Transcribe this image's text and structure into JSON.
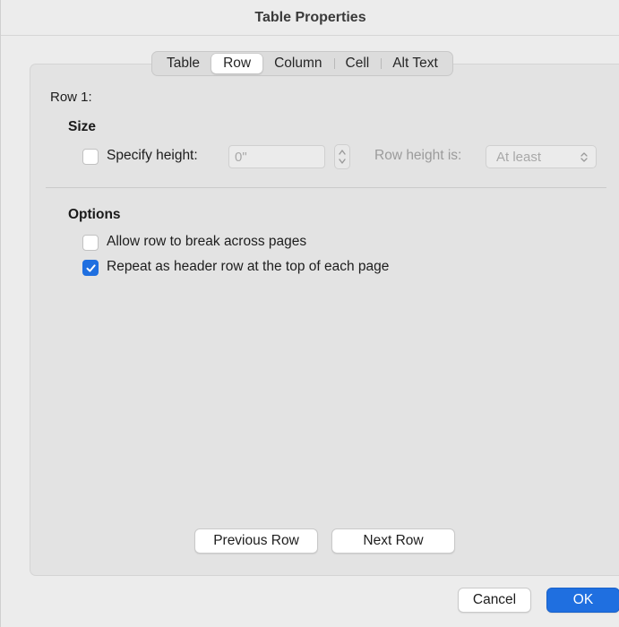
{
  "window": {
    "title": "Table Properties"
  },
  "tabs": [
    {
      "label": "Table",
      "active": false
    },
    {
      "label": "Row",
      "active": true
    },
    {
      "label": "Column",
      "active": false
    },
    {
      "label": "Cell",
      "active": false
    },
    {
      "label": "Alt Text",
      "active": false
    }
  ],
  "row_label": "Row 1:",
  "size": {
    "title": "Size",
    "specify_height": {
      "label": "Specify height:",
      "checked": false
    },
    "height_value": "0\"",
    "row_height_is": {
      "label": "Row height is:",
      "selected": "At least"
    }
  },
  "options": {
    "title": "Options",
    "allow_break": {
      "label": "Allow row to break across pages",
      "checked": false
    },
    "repeat_header": {
      "label": "Repeat as header row at the top of each page",
      "checked": true
    }
  },
  "nav": {
    "previous": "Previous Row",
    "next": "Next Row"
  },
  "footer": {
    "cancel": "Cancel",
    "ok": "OK"
  },
  "colors": {
    "accent": "#1f6fe0"
  }
}
